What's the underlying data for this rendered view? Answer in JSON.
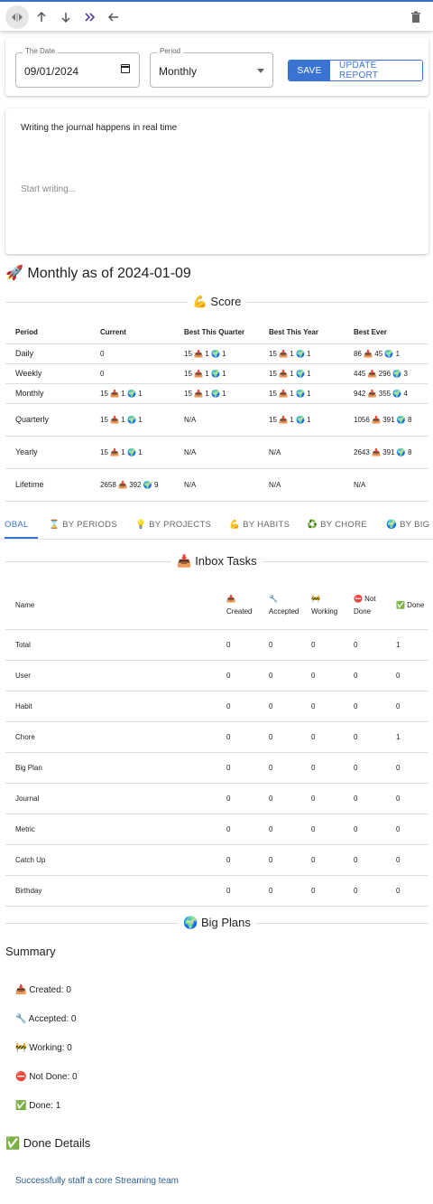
{
  "toolbar": {
    "icons": [
      "code-toggle-icon",
      "arrow-up-icon",
      "arrow-down-icon",
      "double-chevron-icon",
      "arrow-left-icon",
      "trash-icon"
    ]
  },
  "form": {
    "date_label": "The Date",
    "date_value": "09/01/2024",
    "period_label": "Period",
    "period_value": "Monthly",
    "save_label": "SAVE",
    "update_label": "UPDATE REPORT"
  },
  "journal": {
    "info": "Writing the journal happens in real time",
    "placeholder": "Start writing..."
  },
  "report_title": "🚀 Monthly as of 2024-01-09",
  "score": {
    "heading": "💪 Score",
    "columns": [
      "Period",
      "Current",
      "Best This Quarter",
      "Best This Year",
      "Best Ever"
    ],
    "rows": [
      [
        "Daily",
        "0",
        "15 📥 1 🌍 1",
        "15 📥 1 🌍 1",
        "86 📥 45 🌍 1"
      ],
      [
        "Weekly",
        "0",
        "15 📥 1 🌍 1",
        "15 📥 1 🌍 1",
        "445 📥 296 🌍 3"
      ],
      [
        "Monthly",
        "15 📥 1 🌍 1",
        "15 📥 1 🌍 1",
        "15 📥 1 🌍 1",
        "942 📥 355 🌍 4"
      ],
      [
        "Quarterly",
        "15 📥 1 🌍 1",
        "N/A",
        "15 📥 1 🌍 1",
        "1056 📥 391 🌍 8"
      ],
      [
        "Yearly",
        "15 📥 1 🌍 1",
        "N/A",
        "N/A",
        "2643 📥 391 🌍 8"
      ],
      [
        "Lifetime",
        "2658 📥 392 🌍 9",
        "N/A",
        "N/A",
        "N/A"
      ]
    ]
  },
  "tabs": [
    "OBAL",
    "⌛ BY PERIODS",
    "💡 BY PROJECTS",
    "💪 BY HABITS",
    "♻️ BY CHORE",
    "🌍 BY BIG"
  ],
  "inbox": {
    "heading": "📥 Inbox Tasks",
    "columns": [
      "Name",
      "📥 Created",
      "🔧 Accepted",
      "🚧 Working",
      "⛔ Not Done",
      "✅ Done"
    ],
    "rows": [
      [
        "Total",
        "0",
        "0",
        "0",
        "0",
        "1"
      ],
      [
        "User",
        "0",
        "0",
        "0",
        "0",
        "0"
      ],
      [
        "Habit",
        "0",
        "0",
        "0",
        "0",
        "0"
      ],
      [
        "Chore",
        "0",
        "0",
        "0",
        "0",
        "1"
      ],
      [
        "Big Plan",
        "0",
        "0",
        "0",
        "0",
        "0"
      ],
      [
        "Journal",
        "0",
        "0",
        "0",
        "0",
        "0"
      ],
      [
        "Metric",
        "0",
        "0",
        "0",
        "0",
        "0"
      ],
      [
        "Catch Up",
        "0",
        "0",
        "0",
        "0",
        "0"
      ],
      [
        "Birthday",
        "0",
        "0",
        "0",
        "0",
        "0"
      ]
    ]
  },
  "big_plans": {
    "heading": "🌍 Big Plans",
    "summary_title": "Summary",
    "summary": [
      "📥 Created: 0",
      "🔧 Accepted: 0",
      "🚧 Working: 0",
      "⛔ Not Done: 0",
      "✅ Done: 1"
    ],
    "done_title": "✅ Done Details",
    "done_link": "Successfully staff a core Streaming team"
  }
}
